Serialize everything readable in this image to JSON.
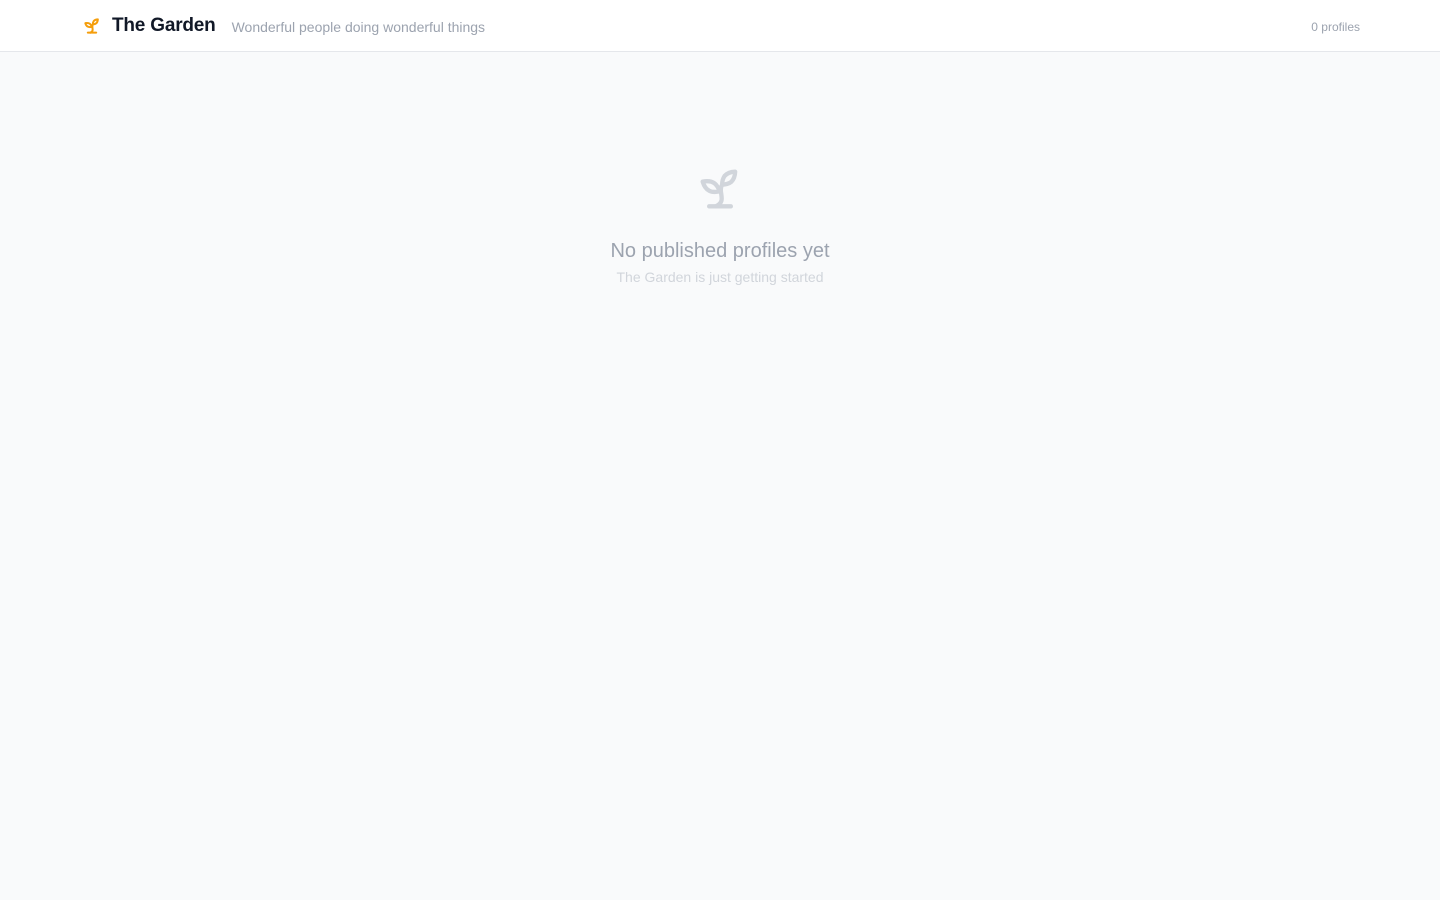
{
  "header": {
    "logo_icon": "seedling-icon",
    "title": "The Garden",
    "tagline": "Wonderful people doing wonderful things",
    "profile_count": "0 profiles"
  },
  "empty_state": {
    "icon": "seedling-icon",
    "title": "No published profiles yet",
    "subtitle": "The Garden is just getting started"
  },
  "colors": {
    "accent": "#f59e0b",
    "background": "#f9fafb",
    "header_background": "#ffffff",
    "title_text": "#111827",
    "muted_text": "#9ca3af",
    "faint_text": "#d1d5db"
  }
}
